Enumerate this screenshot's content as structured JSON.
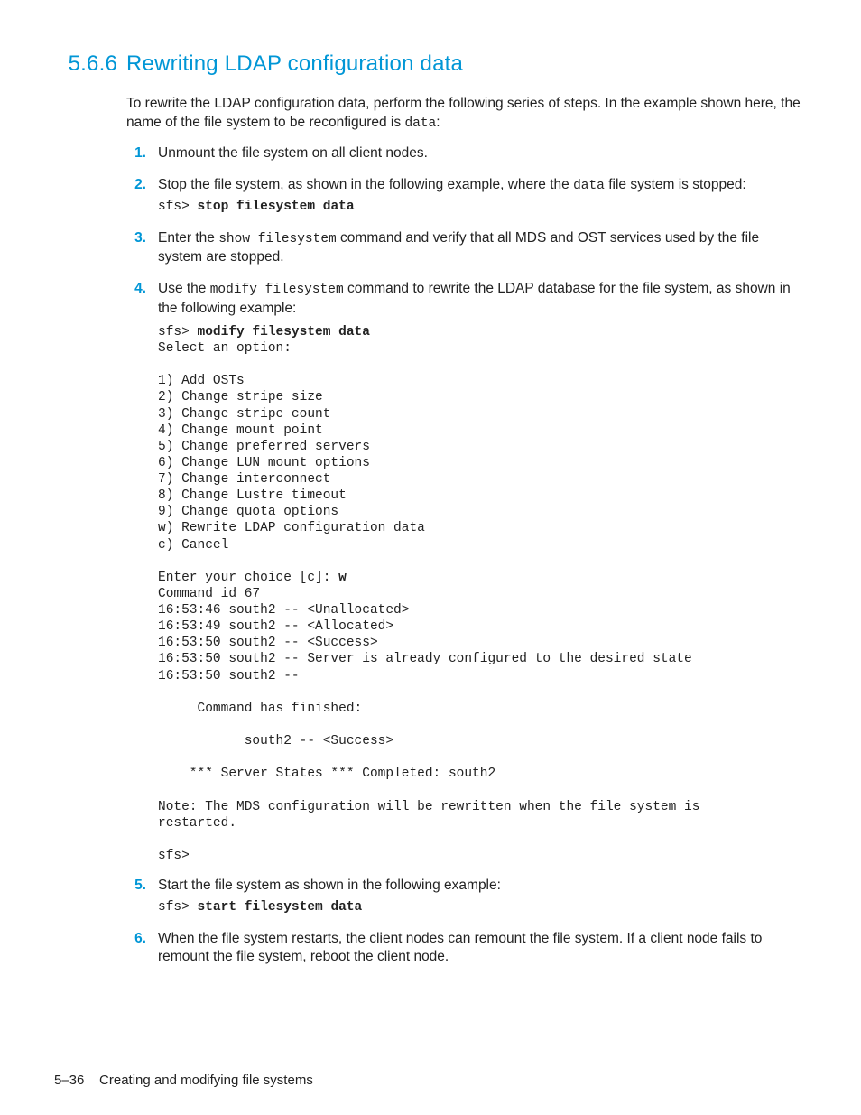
{
  "heading": {
    "number": "5.6.6",
    "title": "Rewriting LDAP configuration data"
  },
  "intro": {
    "t1": "To rewrite the LDAP configuration data, perform the following series of steps. In the example shown here, the name of the file system to be reconfigured is ",
    "code": "data",
    "t2": ":"
  },
  "steps": {
    "s1": {
      "num": "1.",
      "text": "Unmount the file system on all client nodes."
    },
    "s2": {
      "num": "2.",
      "t1": "Stop the file system, as shown in the following example, where the ",
      "code1": "data",
      "t2": " file system is stopped:",
      "prompt": "sfs> ",
      "cmd": "stop filesystem data"
    },
    "s3": {
      "num": "3.",
      "t1": "Enter the ",
      "code1": "show filesystem",
      "t2": " command and verify that all MDS and OST services used by the file system are stopped."
    },
    "s4": {
      "num": "4.",
      "t1": "Use the ",
      "code1": "modify filesystem",
      "t2": " command to rewrite the LDAP database for the file system, as shown in the following example:",
      "block_prefix": "sfs> ",
      "block_cmd": "modify filesystem data",
      "block_a": "Select an option:\n\n1) Add OSTs\n2) Change stripe size\n3) Change stripe count\n4) Change mount point\n5) Change preferred servers\n6) Change LUN mount options\n7) Change interconnect\n8) Change Lustre timeout\n9) Change quota options\nw) Rewrite LDAP configuration data\nc) Cancel\n\nEnter your choice [c]: ",
      "block_choice": "w",
      "block_b": "Command id 67\n16:53:46 south2 -- <Unallocated>\n16:53:49 south2 -- <Allocated>\n16:53:50 south2 -- <Success>\n16:53:50 south2 -- Server is already configured to the desired state\n16:53:50 south2 --\n\n     Command has finished:\n\n           south2 -- <Success>\n\n    *** Server States *** Completed: south2\n\nNote: The MDS configuration will be rewritten when the file system is \nrestarted.\n\nsfs>"
    },
    "s5": {
      "num": "5.",
      "text": "Start the file system as shown in the following example:",
      "prompt": "sfs> ",
      "cmd": "start filesystem data"
    },
    "s6": {
      "num": "6.",
      "text": "When the file system restarts, the client nodes can remount the file system. If a client node fails to remount the file system, reboot the client node."
    }
  },
  "footer": {
    "pagenum": "5–36",
    "chapter": "Creating and modifying file systems"
  }
}
